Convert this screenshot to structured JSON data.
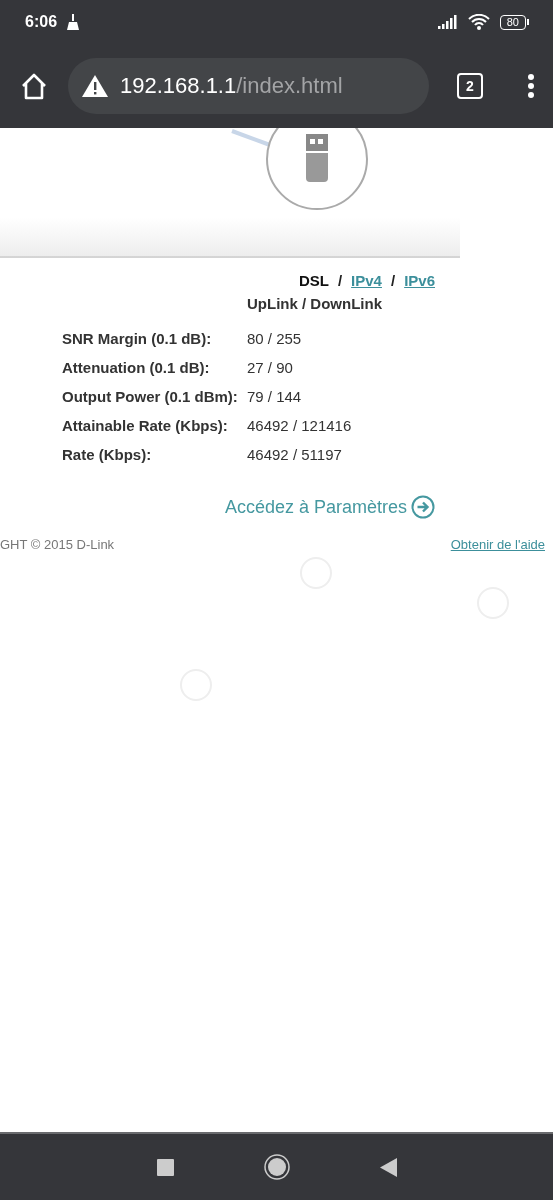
{
  "status_bar": {
    "time": "6:06",
    "battery": "80"
  },
  "browser": {
    "url_host": "192.168.1.1",
    "url_path": "/index.html",
    "tab_count": "2"
  },
  "tabs": [
    {
      "label": "DSL",
      "selected": true
    },
    {
      "label": "IPv4",
      "selected": false
    },
    {
      "label": "IPv6",
      "selected": false
    }
  ],
  "tab_separator": "/",
  "table": {
    "header": "UpLink / DownLink",
    "rows": [
      {
        "label": "SNR Margin (0.1 dB):",
        "value": "80 / 255"
      },
      {
        "label": "Attenuation (0.1 dB):",
        "value": "27 / 90"
      },
      {
        "label": "Output Power (0.1 dBm):",
        "value": "79 / 144"
      },
      {
        "label": "Attainable Rate (Kbps):",
        "value": "46492 / 121416"
      },
      {
        "label": "Rate (Kbps):",
        "value": "46492 / 51197"
      }
    ]
  },
  "settings_link": "Accédez à Paramètres",
  "footer": {
    "copyright": "GHT © 2015 D-Link",
    "help_link": "Obtenir de l'aide"
  }
}
